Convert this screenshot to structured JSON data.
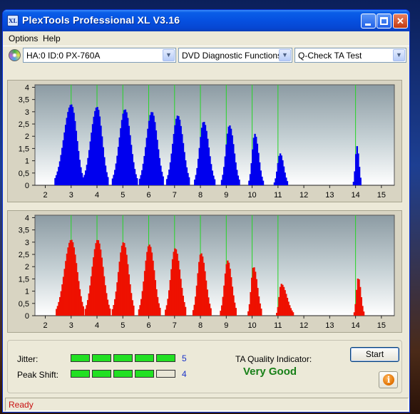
{
  "window": {
    "title": "PlexTools Professional XL V3.16",
    "icon_text": "XL",
    "controls": {
      "minimize": "",
      "maximize": "",
      "close": "✕"
    }
  },
  "menu": {
    "items": [
      "Options",
      "Help"
    ]
  },
  "toolbar": {
    "drive": "HA:0 ID:0  PX-760A",
    "function": "DVD Diagnostic Functions",
    "test": "Q-Check TA Test",
    "arrow": "▼"
  },
  "chart_data": [
    {
      "type": "bar",
      "name": "top",
      "color": "#0000ee",
      "x_ticks": [
        2,
        3,
        4,
        5,
        6,
        7,
        8,
        9,
        10,
        11,
        12,
        13,
        14,
        15
      ],
      "y_ticks": [
        "0",
        "0,5",
        "1",
        "1,5",
        "2",
        "2,5",
        "3",
        "3,5",
        "4"
      ],
      "xlim": [
        1.6,
        15.5
      ],
      "ylim": [
        0,
        4.1
      ],
      "green_lines": [
        3,
        4,
        5,
        6,
        7,
        8,
        9,
        10,
        11,
        14
      ],
      "peaks": [
        {
          "center": 3.0,
          "height": 3.3,
          "start": 2.38,
          "end": 3.47
        },
        {
          "center": 4.0,
          "height": 3.2,
          "start": 3.47,
          "end": 4.43
        },
        {
          "center": 5.08,
          "height": 3.1,
          "start": 4.6,
          "end": 5.55
        },
        {
          "center": 6.12,
          "height": 3.0,
          "start": 5.65,
          "end": 6.58
        },
        {
          "center": 7.12,
          "height": 2.85,
          "start": 6.7,
          "end": 7.58
        },
        {
          "center": 8.12,
          "height": 2.6,
          "start": 7.78,
          "end": 8.55
        },
        {
          "center": 9.12,
          "height": 2.45,
          "start": 8.82,
          "end": 9.5
        },
        {
          "center": 10.1,
          "height": 2.1,
          "start": 9.88,
          "end": 10.42
        },
        {
          "center": 11.08,
          "height": 1.3,
          "start": 10.86,
          "end": 11.38
        },
        {
          "center": 14.05,
          "height": 1.6,
          "start": 13.92,
          "end": 14.22
        }
      ]
    },
    {
      "type": "bar",
      "name": "bottom",
      "color": "#ee1100",
      "x_ticks": [
        2,
        3,
        4,
        5,
        6,
        7,
        8,
        9,
        10,
        11,
        12,
        13,
        14,
        15
      ],
      "y_ticks": [
        "0",
        "0,5",
        "1",
        "1,5",
        "2",
        "2,5",
        "3",
        "3,5",
        "4"
      ],
      "xlim": [
        1.6,
        15.5
      ],
      "ylim": [
        0,
        4.1
      ],
      "green_lines": [
        3,
        4,
        5,
        6,
        7,
        8,
        9,
        10,
        11,
        14
      ],
      "peaks": [
        {
          "center": 3.0,
          "height": 3.1,
          "start": 2.43,
          "end": 3.5
        },
        {
          "center": 4.02,
          "height": 3.1,
          "start": 3.55,
          "end": 4.5
        },
        {
          "center": 5.02,
          "height": 3.0,
          "start": 4.6,
          "end": 5.45
        },
        {
          "center": 6.02,
          "height": 2.9,
          "start": 5.62,
          "end": 6.45
        },
        {
          "center": 7.02,
          "height": 2.75,
          "start": 6.65,
          "end": 7.45
        },
        {
          "center": 8.02,
          "height": 2.55,
          "start": 7.72,
          "end": 8.42
        },
        {
          "center": 9.05,
          "height": 2.25,
          "start": 8.78,
          "end": 9.4
        },
        {
          "center": 10.05,
          "height": 2.0,
          "start": 9.85,
          "end": 10.38
        },
        {
          "center": 11.12,
          "height": 1.3,
          "start": 10.95,
          "end": 11.6
        },
        {
          "center": 14.1,
          "height": 1.55,
          "start": 13.95,
          "end": 14.32
        }
      ]
    }
  ],
  "quality": {
    "jitter_label": "Jitter:",
    "jitter_value": "5",
    "jitter_level": 5,
    "peak_label": "Peak Shift:",
    "peak_value": "4",
    "peak_level": 4,
    "meter_segments": 5,
    "ta_label": "TA Quality Indicator:",
    "ta_value": "Very Good",
    "start_label": "Start",
    "info_glyph": "i"
  },
  "status": {
    "text": "Ready"
  }
}
